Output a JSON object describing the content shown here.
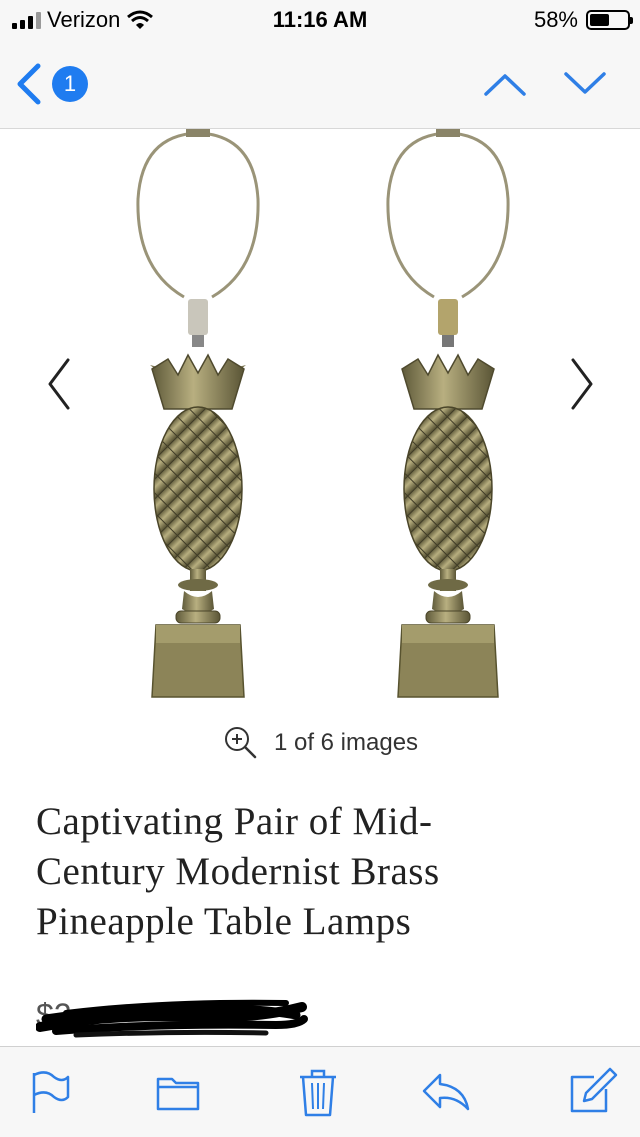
{
  "status_bar": {
    "carrier": "Verizon",
    "time": "11:16 AM",
    "battery_percent": "58%",
    "battery_level": 0.58
  },
  "nav": {
    "unread_count": "1",
    "icons": [
      "chevron-left-icon",
      "chevron-up-icon",
      "chevron-down-icon"
    ]
  },
  "gallery": {
    "counter_text": "1 of 6 images",
    "icons": [
      "chevron-left-icon",
      "chevron-right-icon",
      "zoom-in-icon"
    ]
  },
  "product": {
    "title_lines": [
      "Captivating Pair of Mid-",
      "Century Modernist Brass",
      "Pineapple Table Lamps"
    ],
    "price_visible": "$2"
  },
  "toolbar": {
    "icons": [
      "flag-icon",
      "folder-icon",
      "trash-icon",
      "reply-icon",
      "compose-icon"
    ]
  },
  "colors": {
    "accent": "#1f7cf0",
    "icon_blue": "#2f7fe6",
    "bar_bg": "#f7f7f7",
    "brass": "#8c8458"
  }
}
